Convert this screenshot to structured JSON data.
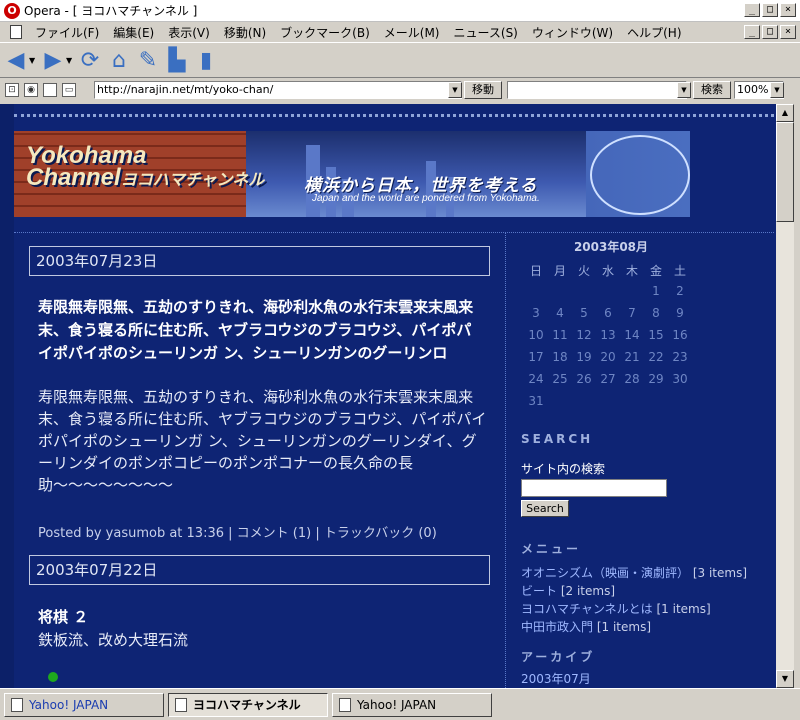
{
  "window": {
    "title": "Opera - [ ヨコハマチャンネル ]",
    "controls": {
      "minimize": "_",
      "maximize": "□",
      "close": "×"
    }
  },
  "menubar": {
    "items": [
      "ファイル(F)",
      "編集(E)",
      "表示(V)",
      "移動(N)",
      "ブックマーク(B)",
      "メール(M)",
      "ニュース(S)",
      "ウィンドウ(W)",
      "ヘルプ(H)"
    ]
  },
  "toolbar": {
    "icons": [
      "back-icon",
      "forward-icon",
      "reload-icon",
      "home-icon",
      "hotlist-icon",
      "print-icon",
      "page-icon"
    ]
  },
  "address_bar": {
    "url": "http://narajin.net/mt/yoko-chan/",
    "go_label": "移動",
    "search_value": "",
    "search_label": "検索",
    "zoom": "100%"
  },
  "banner": {
    "title_en1": "Yokohama",
    "title_en2": "Channel",
    "title_jp": "ヨコハマチャンネル",
    "tagline": "横浜から日本，世界を考える",
    "subtitle": "Japan and the world are pondered from Yokohama."
  },
  "posts": [
    {
      "date": "2003年07月23日",
      "title": "寿限無寿限無、五劫のすりきれ、海砂利水魚の水行末雲来末風来末、食う寝る所に住む所、ヤブラコウジのブラコウジ、パイポパイポパイポのシューリンガ ン、シューリンガンのグーリンロ",
      "body": "寿限無寿限無、五劫のすりきれ、海砂利水魚の水行末雲来末風来末、食う寝る所に住む所、ヤブラコウジのブラコウジ、パイポパイポパイポのシューリンガ ン、シューリンガンのグーリンダイ、グーリンダイのポンポコピーのポンポコナーの長久命の長助〜〜〜〜〜〜〜〜",
      "meta_posted": "Posted by yasumob at 13:36",
      "meta_comments": "コメント (1)",
      "meta_trackback": "トラックバック (0)"
    },
    {
      "date": "2003年07月22日",
      "title": "将棋 ２",
      "body": "鉄板流、改め大理石流"
    }
  ],
  "calendar": {
    "title": "2003年08月",
    "weekdays": [
      "日",
      "月",
      "火",
      "水",
      "木",
      "金",
      "土"
    ],
    "cells": [
      "",
      "",
      "",
      "",
      "",
      "1",
      "2",
      "3",
      "4",
      "5",
      "6",
      "7",
      "8",
      "9",
      "10",
      "11",
      "12",
      "13",
      "14",
      "15",
      "16",
      "17",
      "18",
      "19",
      "20",
      "21",
      "22",
      "23",
      "24",
      "25",
      "26",
      "27",
      "28",
      "29",
      "30",
      "31",
      "",
      "",
      "",
      "",
      "",
      ""
    ]
  },
  "search": {
    "heading": "SEARCH",
    "label": "サイト内の検索",
    "value": "",
    "button": "Search"
  },
  "menu": {
    "heading": "メニュー",
    "items": [
      {
        "label": "オオニシズム（映画・演劇評）",
        "count": "[3 items]"
      },
      {
        "label": "ビート",
        "count": "[2 items]"
      },
      {
        "label": "ヨコハマチャンネルとは",
        "count": "[1 items]"
      },
      {
        "label": "中田市政入門",
        "count": "[1 items]"
      }
    ]
  },
  "archive": {
    "heading": "アーカイブ",
    "items": [
      "2003年07月"
    ]
  },
  "tabs": [
    {
      "label": "Yahoo! JAPAN",
      "active": false
    },
    {
      "label": "ヨコハマチャンネル",
      "active": true
    },
    {
      "label": "Yahoo! JAPAN",
      "active": false
    }
  ],
  "colors": {
    "page_bg": "#0e2474",
    "link": "#9fb8ff",
    "accent_green": "#1ea81e"
  }
}
